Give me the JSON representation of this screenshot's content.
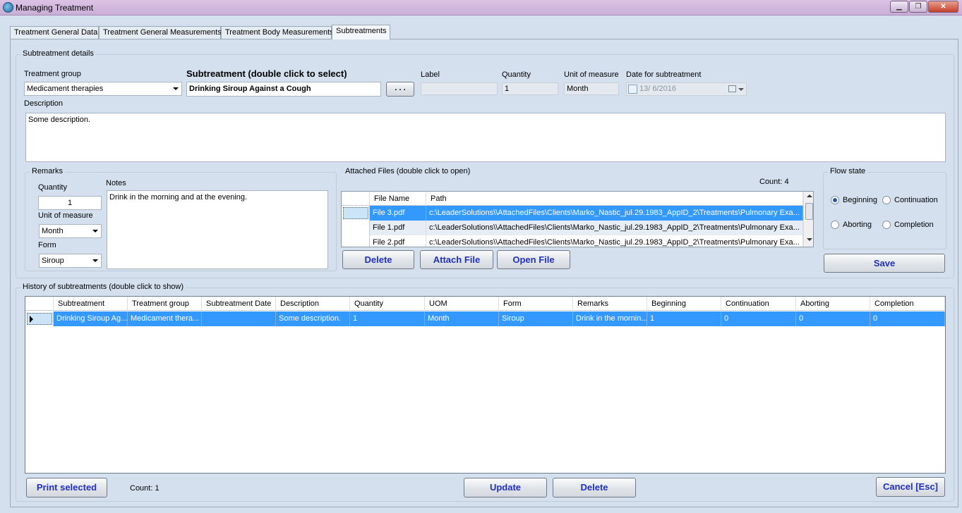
{
  "window": {
    "title": "Managing Treatment",
    "minimize_glyph": "▁",
    "maximize_glyph": "❐",
    "close_glyph": "✕"
  },
  "tabs": [
    {
      "label": "Treatment General Data"
    },
    {
      "label": "Treatment General Measurements"
    },
    {
      "label": "Treatment Body Measurements"
    },
    {
      "label": "Subtreatments"
    }
  ],
  "subtreatment_details": {
    "group_label": "Subtreatment details",
    "treatment_group_label": "Treatment group",
    "treatment_group_value": "Medicament therapies",
    "subtreatment_label": "Subtreatment (double click to select)",
    "subtreatment_value": "Drinking Siroup Against a Cough",
    "browse_button": ". . .",
    "label_label": "Label",
    "label_value": "",
    "quantity_label": "Quantity",
    "quantity_value": "1",
    "uom_label": "Unit of measure",
    "uom_value": "Month",
    "date_label": "Date for subtreatment",
    "date_value": "13/  6/2016",
    "description_label": "Description",
    "description_value": "Some description."
  },
  "remarks": {
    "group_label": "Remarks",
    "quantity_label": "Quantity",
    "quantity_value": "1",
    "uom_label": "Unit of measure",
    "uom_value": "Month",
    "form_label": "Form",
    "form_value": "Siroup",
    "notes_label": "Notes",
    "notes_value": "Drink in the morning and at the evening."
  },
  "attached_files": {
    "group_label": "Attached Files  (double click to open)",
    "count_text": "Count: 4",
    "columns": [
      "File Name",
      "Path"
    ],
    "rows": [
      {
        "name": "File 3.pdf",
        "path": "c:\\LeaderSolutions\\\\AttachedFiles\\Clients\\Marko_Nastic_jul.29.1983_AppID_2\\Treatments\\Pulmonary Exa..."
      },
      {
        "name": "File 1.pdf",
        "path": "c:\\LeaderSolutions\\\\AttachedFiles\\Clients\\Marko_Nastic_jul.29.1983_AppID_2\\Treatments\\Pulmonary Exa..."
      },
      {
        "name": "File 2.pdf",
        "path": "c:\\LeaderSolutions\\\\AttachedFiles\\Clients\\Marko_Nastic_jul.29.1983_AppID_2\\Treatments\\Pulmonary Exa..."
      }
    ],
    "delete_button": "Delete",
    "attach_button": "Attach File",
    "open_button": "Open File"
  },
  "flow_state": {
    "group_label": "Flow state",
    "options": [
      "Beginning",
      "Continuation",
      "Aborting",
      "Completion"
    ],
    "selected": "Beginning",
    "save_button": "Save"
  },
  "history": {
    "group_label": "History of subtreatments  (double click to show)",
    "columns": [
      "Subtreatment",
      "Treatment group",
      "Subtreatment Date",
      "Description",
      "Quantity",
      "UOM",
      "Form",
      "Remarks",
      "Beginning",
      "Continuation",
      "Aborting",
      "Completion"
    ],
    "rows": [
      [
        "Drinking Siroup Ag...",
        "Medicament thera...",
        "",
        "Some description.",
        "1",
        "Month",
        "Siroup",
        "Drink in the mornin...",
        "1",
        "0",
        "0",
        "0"
      ]
    ]
  },
  "footer": {
    "print_button": "Print selected",
    "count_text": "Count: 1",
    "update_button": "Update",
    "delete_button": "Delete",
    "cancel_button": "Cancel [Esc]"
  },
  "colors": {
    "selection": "#3399ff",
    "selection_light": "#cce4f7",
    "button_text": "#2030c0"
  }
}
